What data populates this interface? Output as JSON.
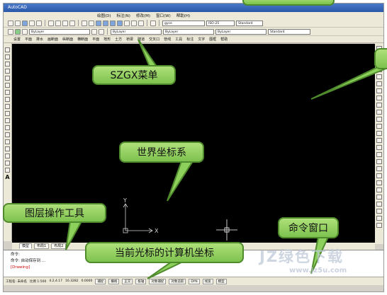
{
  "window": {
    "title": "AutoCAD"
  },
  "menubar": {
    "items": [
      "绘图(D)",
      "标注(N)",
      "修改(M)",
      "窗口(W)",
      "帮助(H)"
    ]
  },
  "toolbar": {
    "layer_combo": "ByLayer",
    "color_combo": "ByLayer",
    "linetype_combo": "ByLayer",
    "lineweight_combo": "ByLayer",
    "style_combo": "Standard",
    "dimstyle_combo": "ISO-25",
    "textstyle_combo": "gyce"
  },
  "szgx_menu": {
    "items": [
      "设置",
      "平面",
      "排水",
      "画断面",
      "纵断面",
      "横断面",
      "平面",
      "地形",
      "土方",
      "桥梁",
      "隧道",
      "交叉口",
      "管线",
      "工具",
      "标注",
      "文字",
      "图框",
      "帮助"
    ]
  },
  "layout_tabs": {
    "items": [
      "模型",
      "布局1",
      "布局2"
    ]
  },
  "command": {
    "line1": "命令:",
    "line2": "命令: 自动保存到 ...",
    "line3": "[Drawing]"
  },
  "statusbar": {
    "items": [
      "工程名: 未命名",
      "比例 1:500",
      "4.2,4.17",
      "16.3282",
      "0.0000",
      "捕捉",
      "栅格",
      "正交",
      "极轴",
      "对象捕捉",
      "对象追踪",
      "DYN",
      "线宽",
      "模型"
    ]
  },
  "callouts": {
    "szgx": "SZGX菜单",
    "wcs": "世界坐标系",
    "layer_tools": "图层操作工具",
    "command_window": "命令窗口",
    "cursor_coords": "当前光标的计算机坐标"
  },
  "canvas": {
    "ucs_x_label": "X",
    "ucs_y_label": "Y"
  },
  "watermark": {
    "text": "JZ绿色下载",
    "url": "www.jz5u.com"
  },
  "colors": {
    "callout_fill": "#8ed05c",
    "callout_border": "#4f8a2c",
    "canvas_bg": "#000000",
    "crosshair": "#ffffff"
  }
}
